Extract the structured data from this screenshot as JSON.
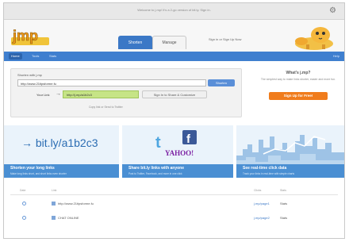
{
  "topbar": {
    "message": "Welcome to j.mp! It's a 2-go version of bit.ly. Sign in."
  },
  "header": {
    "logo_text": "jmp",
    "tabs": [
      {
        "label": "Shorten"
      },
      {
        "label": "Manage"
      }
    ],
    "signin": "Sign in or Sign Up Now"
  },
  "nav": {
    "items": [
      "Home",
      "Tools",
      "Stats"
    ],
    "right": "Help"
  },
  "shorten": {
    "label": "Shorten with j.mp",
    "input_value": "http://www.21tipsforme.fu",
    "go_label": "Shorten",
    "your_link_label": "Your Link",
    "short_link": "http://j.mp/a1b2c3",
    "share_label": "Sign In to Share & Customize",
    "hint": "Copy link  or  Send to Twitter"
  },
  "promo": {
    "title": "What's j.mp?",
    "subtitle": "The simplest way to make links shorter, easier and more fun.",
    "signup": "Sign Up for Free!"
  },
  "features": [
    {
      "hero": "→ bit.ly/a1b2c3",
      "title": "Shorten your long links",
      "subtitle": "Make long links short, and short links even shorter"
    },
    {
      "hero": "YAHOO!",
      "title": "Share bit.ly links with anyone",
      "subtitle": "Post to Twitter, Facebook, and more in one click"
    },
    {
      "hero": "",
      "title": "See real-time click data",
      "subtitle": "Track your links in real-time with simple charts"
    }
  ],
  "table": {
    "headers": [
      "Date",
      "Link",
      "Clicks",
      "Stats"
    ],
    "rows": [
      {
        "url": "http://www.21tipsforme.fu",
        "link": "j.mp/page1",
        "stat": "Stats"
      },
      {
        "url": "CHAT ONLINE",
        "link": "j.mp/page2",
        "stat": "Stats"
      }
    ]
  }
}
